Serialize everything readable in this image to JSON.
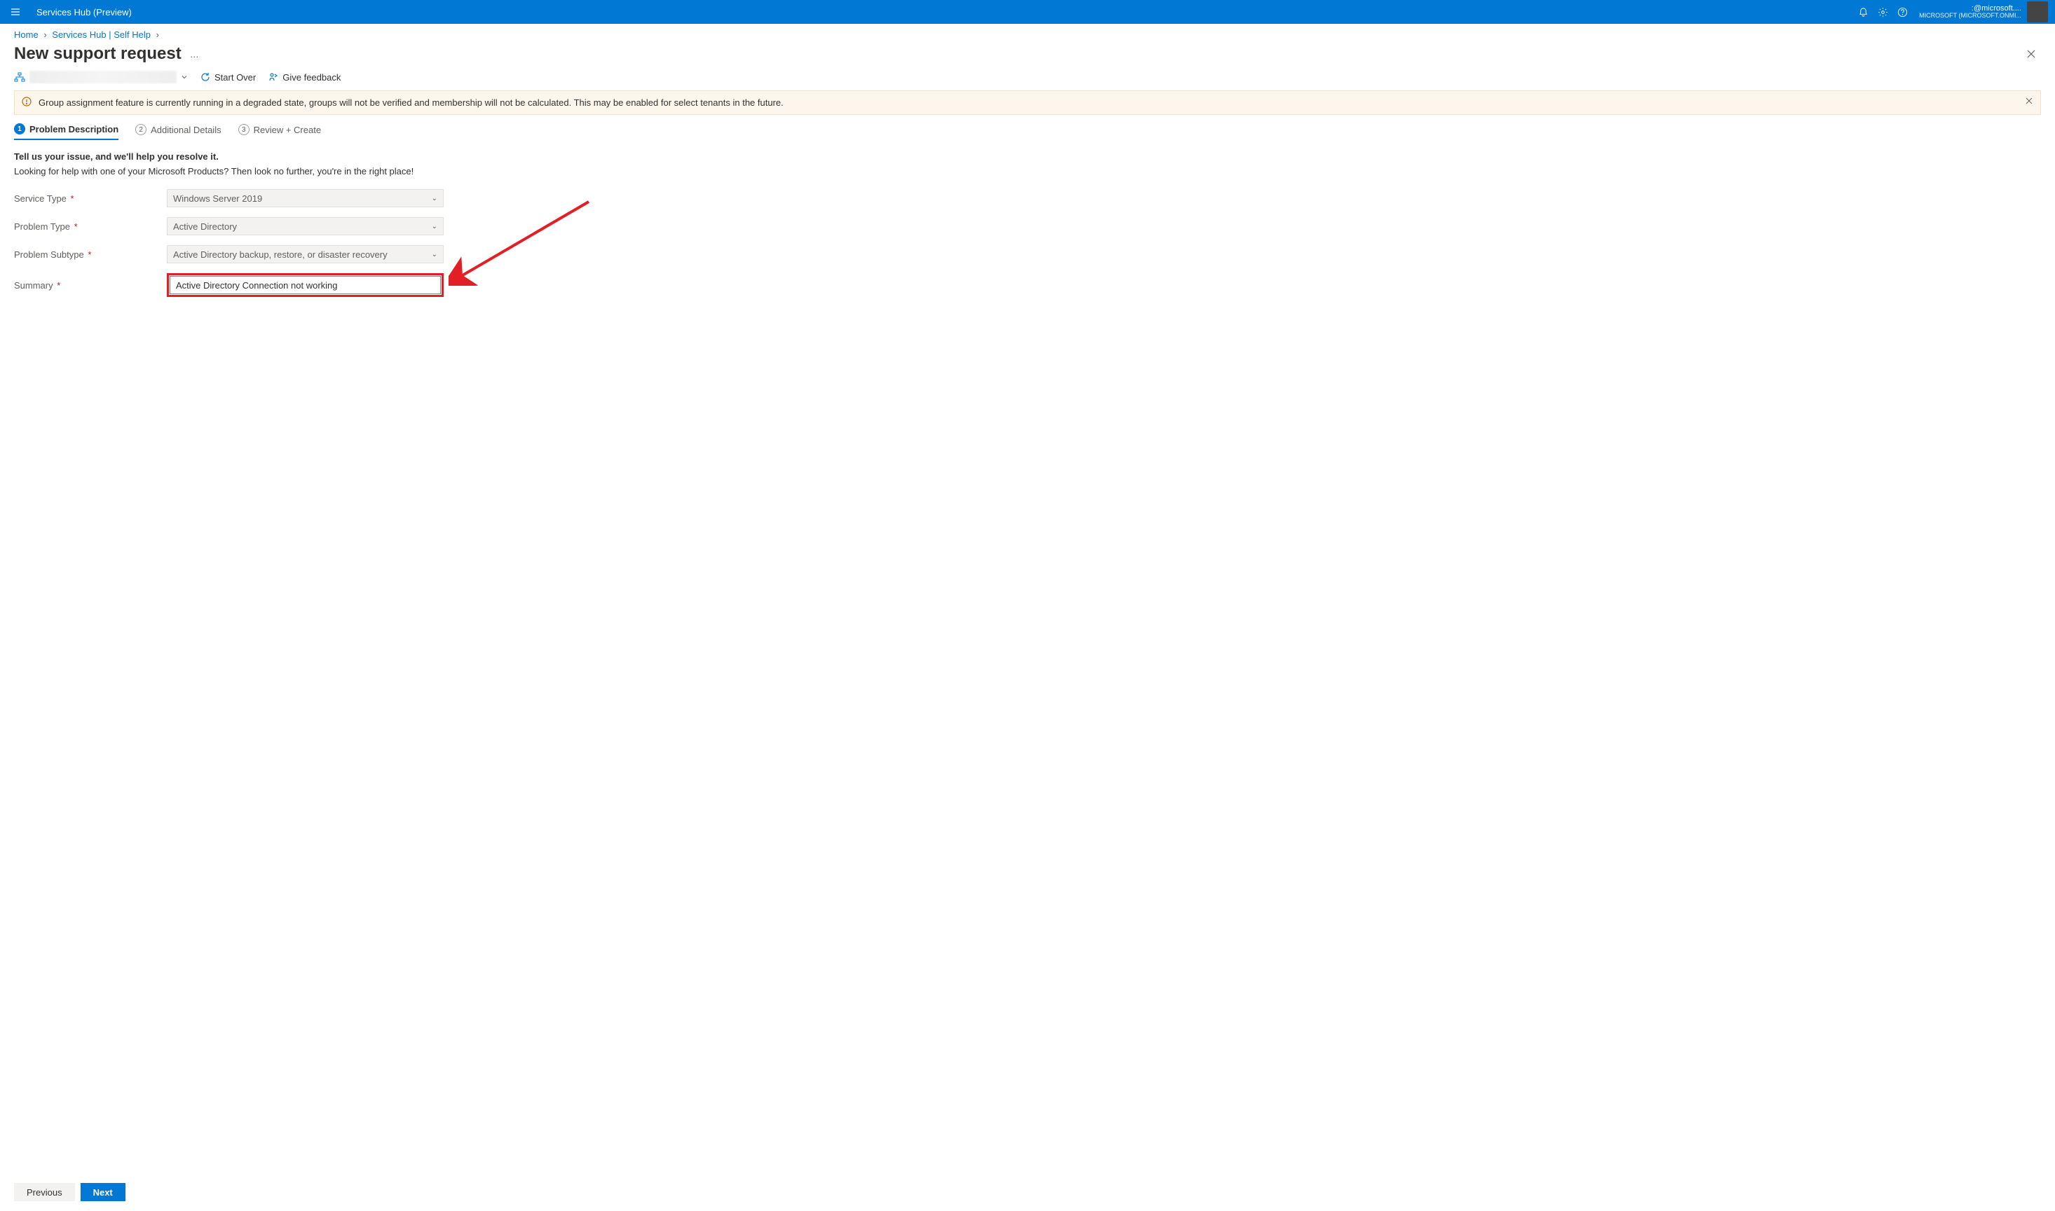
{
  "global": {
    "app_title": "Services Hub (Preview)",
    "user_email": ":@microsoft....",
    "tenant": "MICROSOFT (MICROSOFT.ONMI..."
  },
  "crumbs": {
    "home": "Home",
    "services_hub": "Services Hub | Self Help"
  },
  "page": {
    "title": "New support request",
    "dots": "…"
  },
  "toolbar": {
    "start_over": "Start Over",
    "give_feedback": "Give feedback"
  },
  "warning": {
    "text": "Group assignment feature is currently running in a degraded state, groups will not be verified and membership will not be calculated. This may be enabled for select tenants in the future."
  },
  "tabs": {
    "t1_num": "1",
    "t1_label": "Problem Description",
    "t2_num": "2",
    "t2_label": "Additional Details",
    "t3_num": "3",
    "t3_label": "Review + Create"
  },
  "intro": {
    "line1": "Tell us your issue, and we'll help you resolve it.",
    "line2": "Looking for help with one of your Microsoft Products? Then look no further, you're in the right place!"
  },
  "labels": {
    "service_type": "Service Type",
    "problem_type": "Problem Type",
    "problem_subtype": "Problem Subtype",
    "summary": "Summary",
    "star": "*"
  },
  "fields": {
    "service_type": "Windows Server 2019",
    "problem_type": "Active Directory",
    "problem_subtype": "Active Directory backup, restore, or disaster recovery",
    "summary": "Active Directory Connection not working"
  },
  "footer": {
    "previous": "Previous",
    "next": "Next"
  }
}
